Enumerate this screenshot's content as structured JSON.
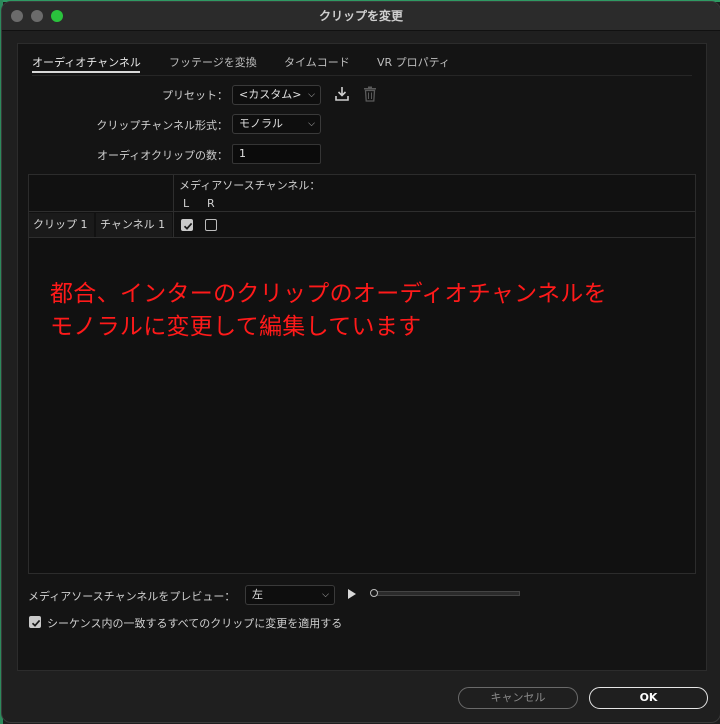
{
  "window": {
    "title": "クリップを変更"
  },
  "tabs": [
    {
      "label": "オーディオチャンネル",
      "active": true
    },
    {
      "label": "フッテージを変換",
      "active": false
    },
    {
      "label": "タイムコード",
      "active": false
    },
    {
      "label": "VR プロパティ",
      "active": false
    }
  ],
  "form": {
    "preset_label": "プリセット：",
    "preset_value": "<カスタム>",
    "format_label": "クリップチャンネル形式：",
    "format_value": "モノラル",
    "count_label": "オーディオクリップの数：",
    "count_value": "1"
  },
  "table": {
    "media_header": "メディアソースチャンネル：",
    "col_l": "L",
    "col_r": "R",
    "rows": [
      {
        "clip": "クリップ 1",
        "channel": "チャンネル 1",
        "l_checked": true,
        "r_checked": false
      }
    ]
  },
  "annotation": {
    "line1": "都合、インターのクリップのオーディオチャンネルを",
    "line2": "モノラルに変更して編集しています"
  },
  "preview": {
    "label": "メディアソースチャンネルをプレビュー：",
    "value": "左",
    "progress": 0
  },
  "apply_all": {
    "label": "シーケンス内の一致するすべてのクリップに変更を適用する",
    "checked": true
  },
  "buttons": {
    "cancel": "キャンセル",
    "ok": "OK"
  },
  "colors": {
    "annotation": "#ff1a1a",
    "maximize": "#2ac33d",
    "background": "#1f1f1f"
  },
  "icons": [
    "save-preset-icon",
    "delete-preset-icon",
    "play-icon",
    "chevron-down-icon",
    "checkmark-icon"
  ]
}
